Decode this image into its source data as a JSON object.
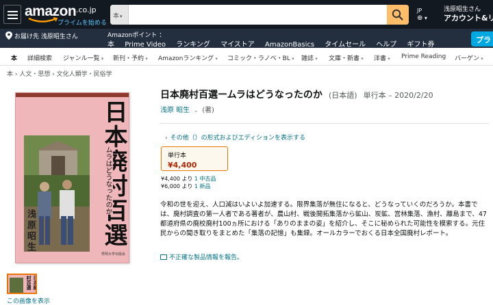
{
  "header": {
    "logo_text": "amazon",
    "logo_tld": ".co.jp",
    "prime_tagline": "プライムを始める",
    "search": {
      "category": "本",
      "value": "",
      "placeholder": ""
    },
    "language": {
      "code": "JP",
      "icon": "globe-icon"
    },
    "account": {
      "greeting": "浅原昭生さん",
      "label": "アカウント&リスト"
    },
    "deliver_to": "お届け先 浅原昭生さん",
    "points_label": "Amazonポイント ：",
    "nav_links": [
      "本",
      "Prime Video",
      "ランキング",
      "マイストア",
      "AmazonBasics",
      "タイムセール",
      "ヘルプ",
      "ギフト券"
    ],
    "prime_banner": "プラ"
  },
  "category_bar": [
    {
      "label": "本",
      "dropdown": false
    },
    {
      "label": "詳細検索",
      "dropdown": false
    },
    {
      "label": "ジャンル一覧",
      "dropdown": true
    },
    {
      "label": "新刊・予約",
      "dropdown": true
    },
    {
      "label": "Amazonランキング",
      "dropdown": true
    },
    {
      "label": "コミック・ラノベ・BL",
      "dropdown": true
    },
    {
      "label": "雑誌",
      "dropdown": true
    },
    {
      "label": "文庫・新書",
      "dropdown": true
    },
    {
      "label": "洋書",
      "dropdown": true
    },
    {
      "label": "Prime Reading",
      "dropdown": false
    },
    {
      "label": "バーゲン",
      "dropdown": true
    }
  ],
  "breadcrumb": "本 › 人文・思想 › 文化人類学・民俗学",
  "product": {
    "title": "日本廃村百選ームラはどうなったのか",
    "language": "(日本語)",
    "binding_date": "単行本 – 2020/2/20",
    "author": "浅原 昭生",
    "author_role": "(著)",
    "other_editions": "その他（）の形式およびエディションを表示する",
    "format": {
      "name": "単行本",
      "price": "¥4,400"
    },
    "offers": [
      {
        "price": "¥4,400 より",
        "link": "1 中古品"
      },
      {
        "price": "¥6,000 より",
        "link": "1 新品"
      }
    ],
    "description": "令和の世を迎え、人口減はいよいよ加速する。限界集落が無住になると、どうなっていくのだろうか。本書では、廃村調査の第一人者である著者が、農山村、戦後開拓集落から鉱山、炭鉱、営林集落、漁村、離島まで、47都道府県の廃校廃村100ヵ所における「ありのままの姿」を紹介し、そこに秘められた可能性を模索する。元住民からの聞き取りをまとめた「集落の記憶」も集録。オールカラーでおくる日本全国廃村レポート。",
    "report_link": "不正確な製品情報を報告。",
    "view_image": "この画像を表示"
  },
  "cover": {
    "title": "日本廃村百選",
    "subtitle": "ムラはどうなったのか",
    "author": "浅原昭生",
    "publisher": "秀明大学出版会",
    "colors": {
      "background": "#f0b7bb",
      "strip": "#8e3a2e"
    }
  }
}
